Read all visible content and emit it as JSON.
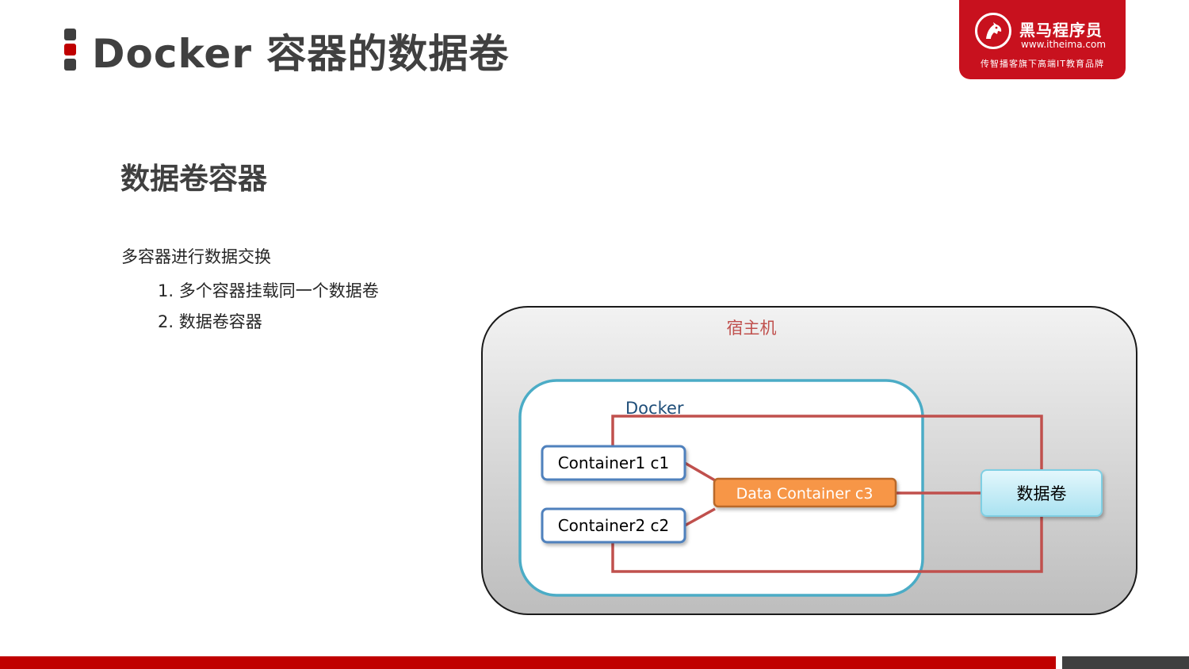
{
  "page": {
    "title": "Docker 容器的数据卷"
  },
  "logo": {
    "name": "黑马程序员",
    "url": "www.itheima.com",
    "slogan": "传智播客旗下高端IT教育品牌",
    "icon": "horse-head-icon"
  },
  "content": {
    "heading": "数据卷容器",
    "intro": "多容器进行数据交换",
    "items": [
      "1. 多个容器挂载同一个数据卷",
      "2. 数据卷容器"
    ]
  },
  "diagram": {
    "host_label": "宿主机",
    "docker_label": "Docker",
    "container1_label": "Container1 c1",
    "container2_label": "Container2 c2",
    "data_container_label": "Data Container c3",
    "volume_label": "数据卷"
  },
  "colors": {
    "brand_red": "#c8111e",
    "accent_red": "#c00000",
    "title_gray": "#404040",
    "docker_border": "#4bacc6",
    "container_border": "#4f81bd",
    "data_container_fill": "#f79646",
    "link_line": "#c0504d",
    "volume_fill": "#bfe9f5",
    "host_label": "#c0504d"
  }
}
